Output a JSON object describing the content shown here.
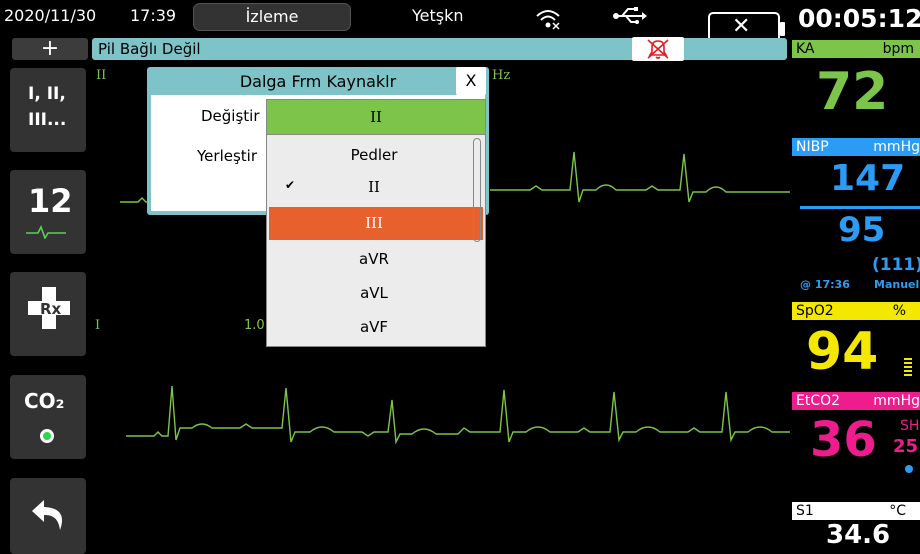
{
  "status_bar": {
    "date": "2020/11/30",
    "time": "17:39",
    "mode": "İzleme",
    "patient_type": "Yetşkn",
    "wifi_icon": "wifi-off-icon",
    "usb_icon": "usb-icon",
    "battery_icon": "battery-missing-icon",
    "elapsed": "00:05:12"
  },
  "alert_bar": {
    "add_label": "+",
    "message": "Pil Bağlı Değil",
    "mute_icon": "alarm-off-icon"
  },
  "left_rail": {
    "leads_button": {
      "line1": "I, II,",
      "line2": "III..."
    },
    "twelve_lead_button": {
      "label": "12"
    },
    "rx_button": {
      "label": "Rx"
    },
    "co2_button": {
      "label": "CO₂"
    },
    "back_button": {
      "icon": "back-arrow-icon"
    }
  },
  "ecg": {
    "lead_top": "II",
    "lead_bottom": "I",
    "filter_partial": "Hz",
    "gain_partial": "1.0"
  },
  "dialog": {
    "title": "Dalga Frm Kaynaklr",
    "close_label": "X",
    "change_label": "Değiştir",
    "place_label": "Yerleştir",
    "selected_value": "II",
    "options": [
      {
        "label": "Pedler",
        "checked": false,
        "highlighted": false
      },
      {
        "label": "II",
        "checked": true,
        "highlighted": false
      },
      {
        "label": "III",
        "checked": false,
        "highlighted": true
      },
      {
        "label": "aVR",
        "checked": false,
        "highlighted": false
      },
      {
        "label": "aVL",
        "checked": false,
        "highlighted": false
      },
      {
        "label": "aVF",
        "checked": false,
        "highlighted": false
      }
    ]
  },
  "params": {
    "hr": {
      "name": "KA",
      "unit": "bpm",
      "value": "72",
      "color": "#7cc44a"
    },
    "nibp": {
      "name": "NIBP",
      "unit": "mmHg",
      "systolic": "147",
      "diastolic": "95",
      "mean": "(111)",
      "time": "@ 17:36",
      "mode": "Manuel",
      "color": "#2b9cf5"
    },
    "spo2": {
      "name": "SpO2",
      "unit": "%",
      "value": "94",
      "color": "#f5e800"
    },
    "etco2": {
      "name": "EtCO2",
      "unit": "mmHg",
      "value": "36",
      "resp_label": "SH",
      "resp_value": "25",
      "color": "#ee1c8c"
    },
    "temp": {
      "name": "S1",
      "unit": "°C",
      "value": "34.6",
      "color": "#ffffff"
    }
  }
}
